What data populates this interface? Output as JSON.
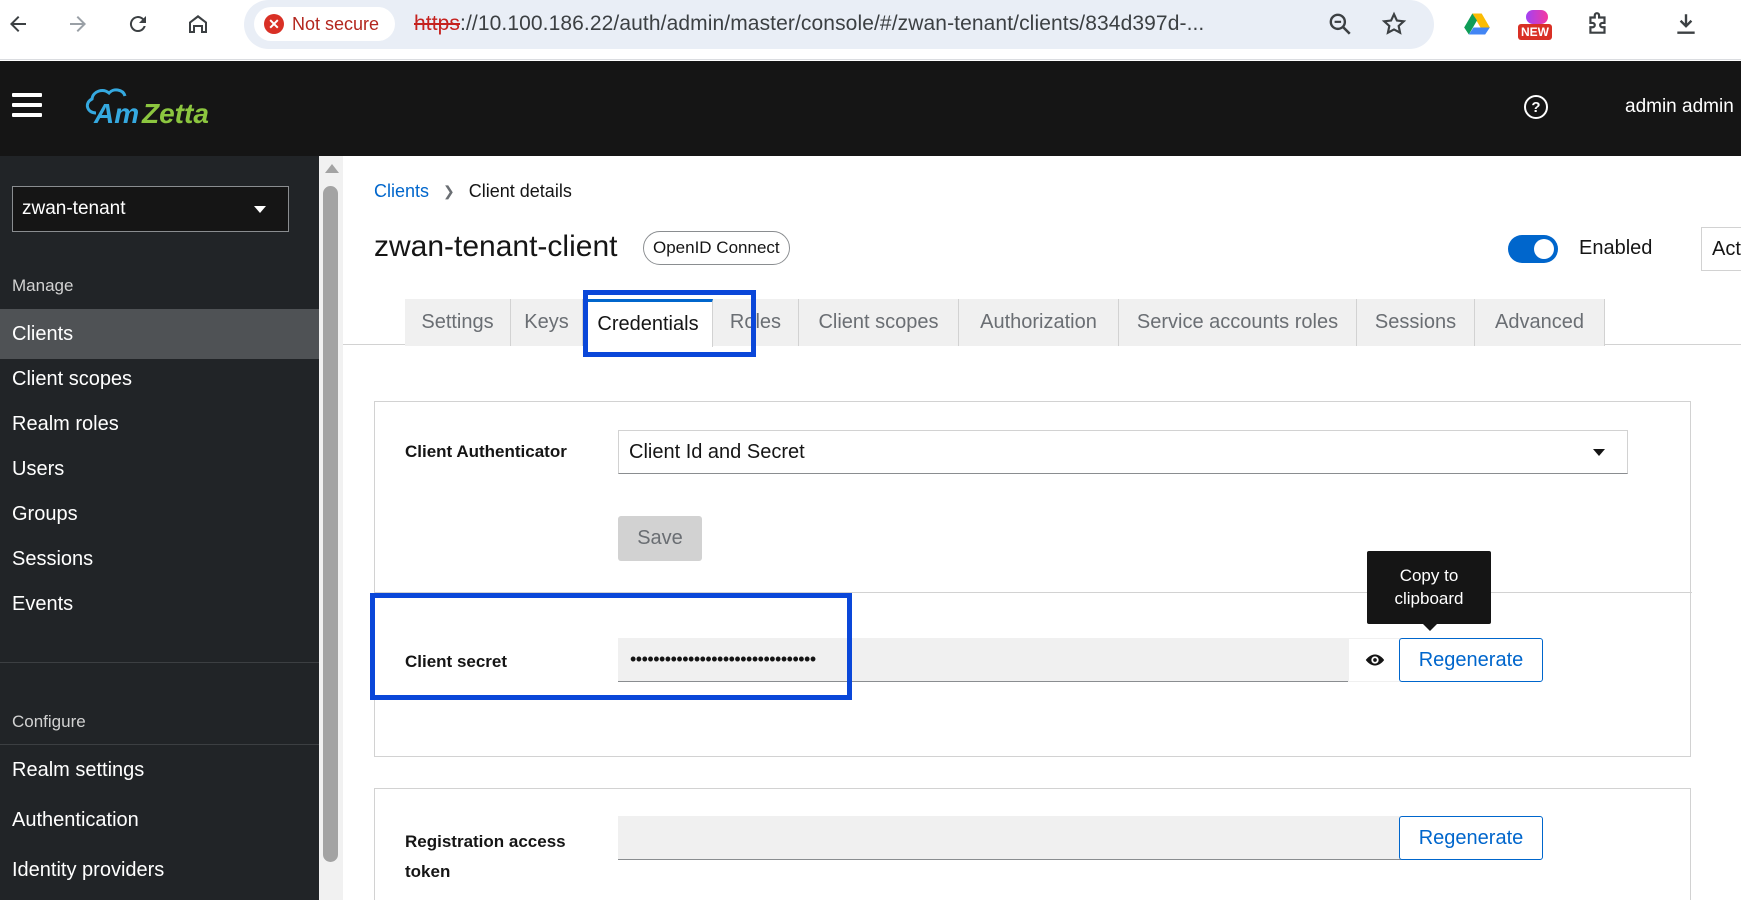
{
  "browser": {
    "security_label": "Not secure",
    "url_scheme": "https",
    "url_rest": "://10.100.186.22/auth/admin/master/console/#/zwan-tenant/clients/834d397d-...",
    "new_badge": "NEW"
  },
  "header": {
    "logo_text": "AmZetta",
    "user_label": "admin admin"
  },
  "sidebar": {
    "realm": "zwan-tenant",
    "manage_label": "Manage",
    "manage_items": [
      "Clients",
      "Client scopes",
      "Realm roles",
      "Users",
      "Groups",
      "Sessions",
      "Events"
    ],
    "configure_label": "Configure",
    "configure_items": [
      "Realm settings",
      "Authentication",
      "Identity providers"
    ],
    "active_item": "Clients"
  },
  "breadcrumb": {
    "parent": "Clients",
    "current": "Client details"
  },
  "client": {
    "name": "zwan-tenant-client",
    "protocol": "OpenID Connect",
    "enabled_label": "Enabled",
    "enabled": true,
    "action_label": "Act"
  },
  "tabs": [
    "Settings",
    "Keys",
    "Credentials",
    "Roles",
    "Client scopes",
    "Authorization",
    "Service accounts roles",
    "Sessions",
    "Advanced"
  ],
  "active_tab": "Credentials",
  "credentials": {
    "authenticator_label": "Client Authenticator",
    "authenticator_value": "Client Id and Secret",
    "save_label": "Save",
    "secret_label": "Client secret",
    "secret_value": "••••••••••••••••••••••••••••••••",
    "regenerate_label": "Regenerate",
    "tooltip_line1": "Copy to",
    "tooltip_line2": "clipboard",
    "reg_token_label_line1": "Registration access",
    "reg_token_label_line2": "token",
    "reg_token_value": ""
  },
  "colors": {
    "accent": "#0066cc",
    "highlight": "#0a47d9",
    "header_bg": "#151515",
    "sidebar_bg": "#212427"
  },
  "icons": {
    "back": "arrow-left-icon",
    "forward": "arrow-right-icon",
    "reload": "reload-icon",
    "home": "home-icon",
    "zoom": "zoom-icon",
    "bookmark": "star-icon",
    "drive": "google-drive-icon",
    "extensions": "puzzle-icon",
    "download": "download-icon",
    "help": "help-icon",
    "show": "eye-icon",
    "copy": "copy-icon"
  }
}
